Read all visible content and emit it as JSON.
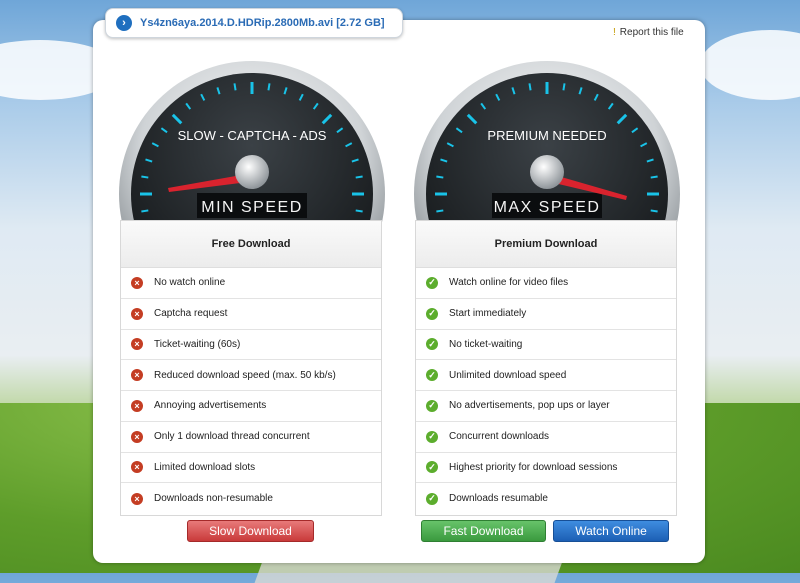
{
  "file": {
    "name": "Ys4zn6aya.2014.D.HDRip.2800Mb.avi [2.72 GB]"
  },
  "report": {
    "label": "Report this file"
  },
  "free": {
    "gauge_top": "SLOW - CAPTCHA - ADS",
    "gauge_bottom": "MIN SPEED",
    "title": "Free Download",
    "features": [
      "No watch online",
      "Captcha request",
      "Ticket-waiting (60s)",
      "Reduced download speed (max. 50 kb/s)",
      "Annoying advertisements",
      "Only 1 download thread concurrent",
      "Limited download slots",
      "Downloads non-resumable"
    ],
    "button": "Slow Download"
  },
  "premium": {
    "gauge_top": "PREMIUM NEEDED",
    "gauge_bottom": "MAX SPEED",
    "title": "Premium Download",
    "features": [
      "Watch online for video files",
      "Start immediately",
      "No ticket-waiting",
      "Unlimited download speed",
      "No advertisements, pop ups or layer",
      "Concurrent downloads",
      "Highest priority for download sessions",
      "Downloads resumable"
    ],
    "button_fast": "Fast Download",
    "button_watch": "Watch Online"
  },
  "colors": {
    "link": "#2a6bb5",
    "no": "#c43d23",
    "yes": "#5cad2d",
    "needle": "#d9232e",
    "tick": "#19c3e8"
  }
}
